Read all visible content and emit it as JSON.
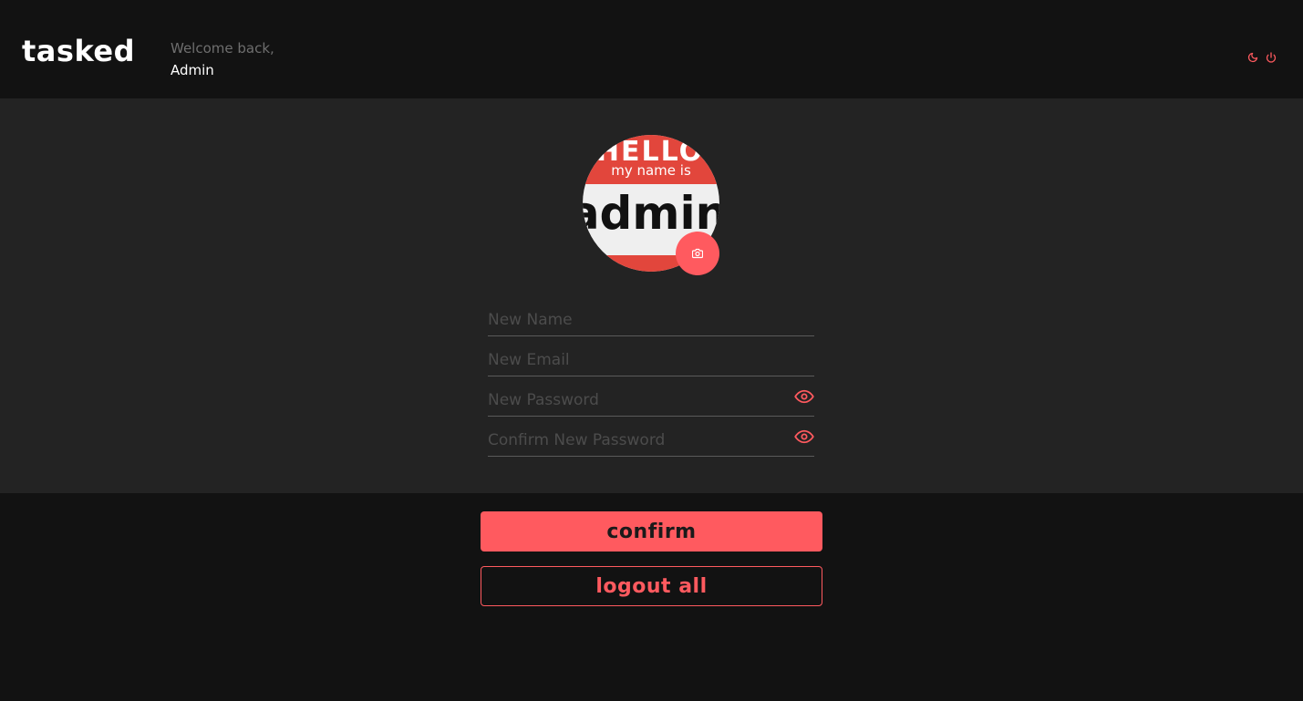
{
  "app": {
    "logo": "tasked"
  },
  "header": {
    "greeting": "Welcome back,",
    "username": "Admin",
    "actions": [
      {
        "icon": "moon-icon",
        "label": "theme toggle"
      },
      {
        "icon": "power-icon",
        "label": "logout"
      }
    ]
  },
  "profile": {
    "avatar": {
      "line1": "HELLO",
      "line2": "my name is",
      "line3": "admin"
    },
    "camera_icon": "camera-icon"
  },
  "form": {
    "name_placeholder": "New Name",
    "email_placeholder": "New Email",
    "password_placeholder": "New Password",
    "confirm_password_placeholder": "Confirm New Password",
    "eye_icon": "eye-icon"
  },
  "buttons": {
    "confirm": "confirm",
    "logout_all": "logout all"
  },
  "colors": {
    "accent": "#ff5a5f",
    "background": "#121212",
    "panel": "#232323",
    "badge_red": "#e2463c",
    "badge_white": "#efefef"
  }
}
